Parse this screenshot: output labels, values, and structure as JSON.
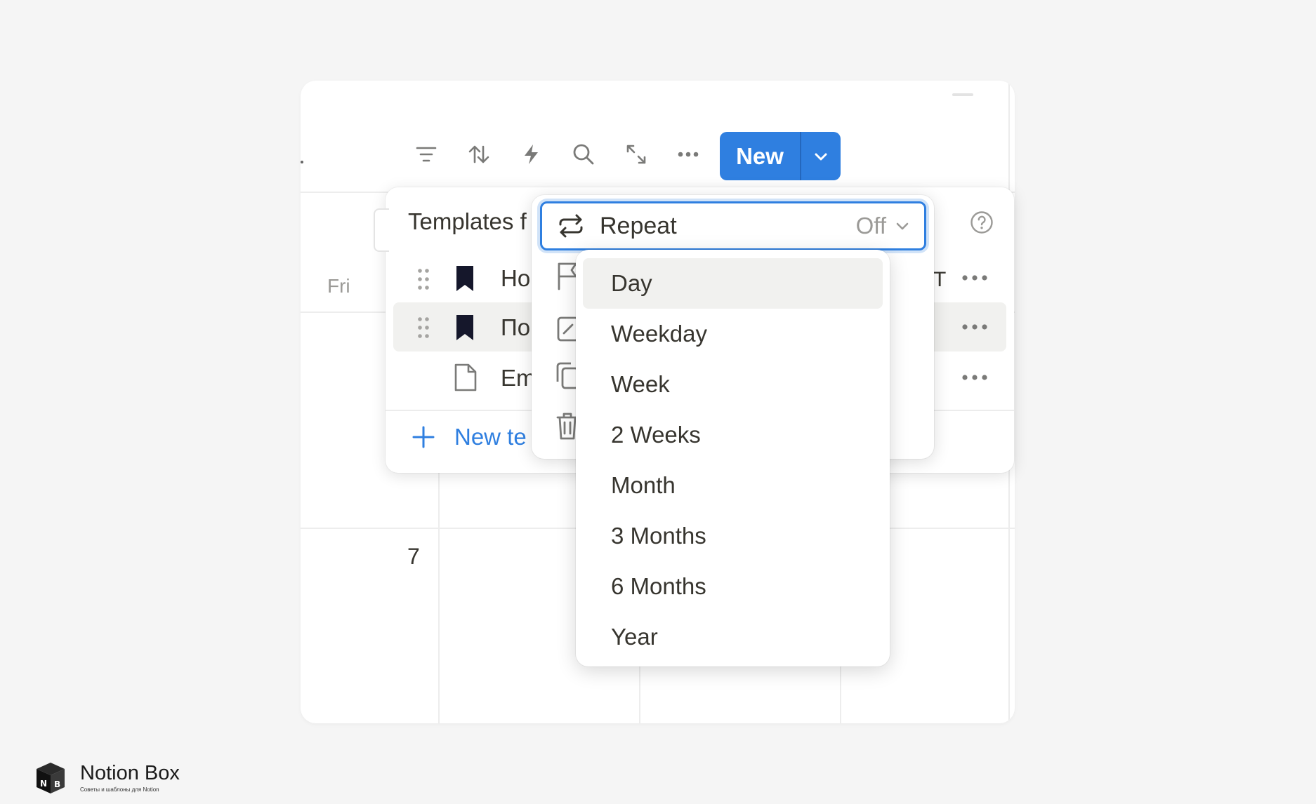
{
  "toolbar": {
    "new_label": "New",
    "icons": [
      "filter-icon",
      "sort-icon",
      "lightning-icon",
      "search-icon",
      "expand-icon",
      "more-icon",
      "chevron-down-icon"
    ]
  },
  "calendar": {
    "day_header": "Fri",
    "date_number": "7"
  },
  "templates_panel": {
    "title": "Templates f",
    "rows": [
      {
        "label": "Но",
        "icon": "bookmark-icon"
      },
      {
        "label": "По",
        "icon": "bookmark-icon"
      },
      {
        "label": "Em",
        "icon": "page-icon"
      }
    ],
    "column_cap": "T",
    "new_template_label": "New te"
  },
  "context_menu": {
    "repeat_label": "Repeat",
    "repeat_value": "Off",
    "icons": [
      "flag-icon",
      "edit-icon",
      "duplicate-icon",
      "trash-icon"
    ]
  },
  "repeat_dropdown": {
    "selected": "Day",
    "options": [
      "Day",
      "Weekday",
      "Week",
      "2 Weeks",
      "Month",
      "3 Months",
      "6 Months",
      "Year"
    ]
  },
  "branding": {
    "name": "Notion Box",
    "tagline": "Советы и шаблоны для Notion",
    "logo_letters": "NB"
  },
  "colors": {
    "accent": "#2f7fe0",
    "background": "#f5f5f5",
    "text": "#37352f",
    "muted": "#9b9a97",
    "bookmark": "#15172b"
  }
}
